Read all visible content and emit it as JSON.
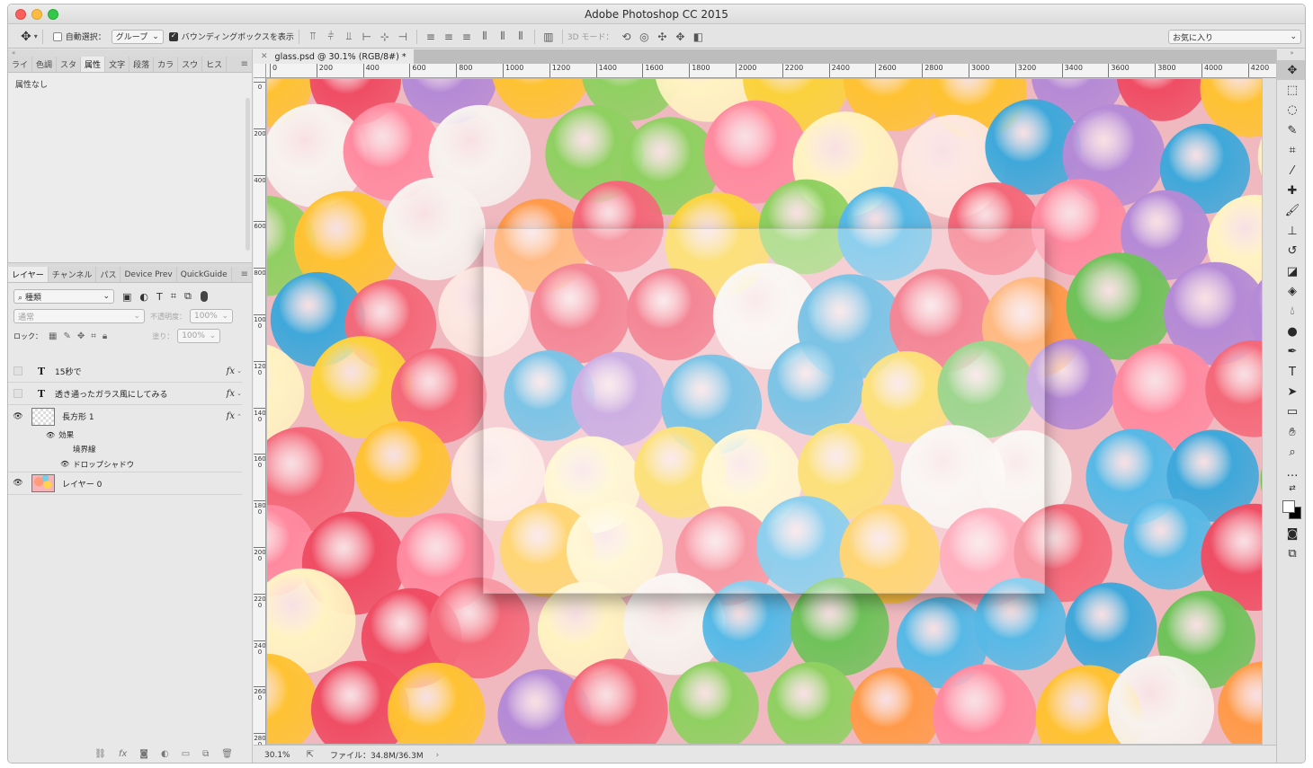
{
  "app": {
    "title": "Adobe Photoshop CC 2015"
  },
  "options": {
    "auto_select_label": "自動選択：",
    "auto_select_target": "グループ",
    "bounding_box_label": "バウンディングボックスを表示",
    "mode_3d_label": "3D モード：",
    "workspace": "お気に入り"
  },
  "top_panel": {
    "tabs": [
      "ライ",
      "色調",
      "スタ",
      "属性",
      "文字",
      "段落",
      "カラ",
      "スウ",
      "ヒス"
    ],
    "active_tab": "属性",
    "body_text": "属性なし"
  },
  "layers_panel": {
    "tabs": [
      "レイヤー",
      "チャンネル",
      "パス",
      "Device Prev",
      "QuickGuide"
    ],
    "filter_label": "種類",
    "blend_mode": "通常",
    "opacity_label": "不透明度：",
    "opacity_value": "100%",
    "lock_label": "ロック：",
    "fill_label": "塗り：",
    "fill_value": "100%",
    "layers": [
      {
        "name": "15秒で",
        "type": "T",
        "visible": false,
        "fx": "fx"
      },
      {
        "name": "透き通ったガラス風にしてみる",
        "type": "T",
        "visible": false,
        "fx": "fx"
      },
      {
        "name": "長方形 1",
        "type": "shape",
        "visible": true,
        "fx": "fx"
      },
      {
        "name": "レイヤー 0",
        "type": "image",
        "visible": true
      }
    ],
    "effects_label": "効果",
    "effect_items": [
      "境界線",
      "ドロップシャドウ"
    ]
  },
  "document": {
    "tab_title": "glass.psd @ 30.1% (RGB/8#) *",
    "ruler_h": [
      "0",
      "200",
      "400",
      "600",
      "800",
      "1000",
      "1200",
      "1400",
      "1600",
      "1800",
      "2000",
      "2200",
      "2400",
      "2600",
      "2800",
      "3000",
      "3200",
      "3400",
      "3600",
      "3800",
      "4000",
      "4200"
    ],
    "ruler_v": [
      "0",
      "200",
      "400",
      "600",
      "800",
      "1000",
      "1200",
      "1400",
      "1600",
      "1800",
      "2000",
      "2200",
      "2400",
      "2600",
      "2800"
    ],
    "zoom": "30.1%",
    "file_info": "ファイル：34.8M/36.3M"
  },
  "tools": [
    "move-tool",
    "marquee-tool",
    "lasso-tool",
    "quick-select-tool",
    "crop-tool",
    "eyedropper-tool",
    "healing-tool",
    "brush-tool",
    "stamp-tool",
    "history-brush-tool",
    "eraser-tool",
    "paint-bucket-tool",
    "blur-tool",
    "dodge-tool",
    "pen-tool",
    "type-tool",
    "path-select-tool",
    "rectangle-tool",
    "hand-tool",
    "zoom-tool",
    "more-tools"
  ],
  "colors": {
    "foreground": "#ffffff",
    "background": "#000000"
  }
}
